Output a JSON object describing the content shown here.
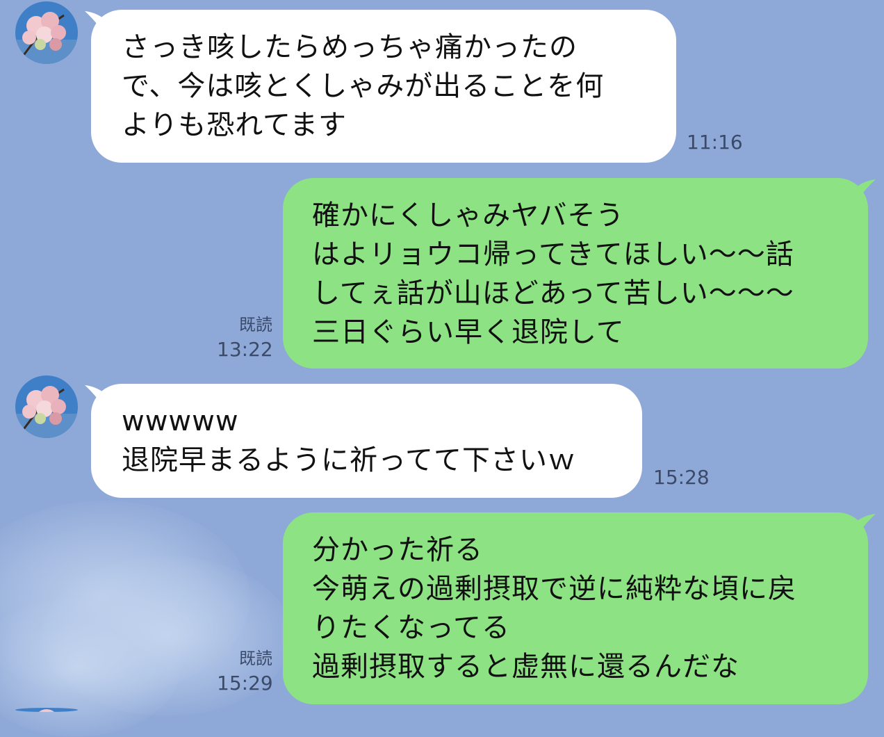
{
  "messages": [
    {
      "direction": "incoming",
      "lines": [
        "さっき咳したらめっちゃ痛かったの",
        "で、今は咳とくしゃみが出ることを何",
        "よりも恐れてます"
      ],
      "time": "11:16"
    },
    {
      "direction": "outgoing",
      "lines": [
        "確かにくしゃみヤバそう",
        "はよリョウコ帰ってきてほしい〜〜話",
        "してぇ話が山ほどあって苦しい〜〜〜",
        "三日ぐらい早く退院して"
      ],
      "read_label": "既読",
      "time": "13:22"
    },
    {
      "direction": "incoming",
      "lines": [
        "wwwww",
        "退院早まるように祈ってて下さいｗ"
      ],
      "time": "15:28"
    },
    {
      "direction": "outgoing",
      "lines": [
        "分かった祈る",
        "今萌えの過剰摂取で逆に純粋な頃に戻",
        "りたくなってる",
        "過剰摂取すると虚無に還るんだな"
      ],
      "read_label": "既読",
      "time": "15:29"
    }
  ],
  "colors": {
    "background": "#8ea8d7",
    "incoming_bubble": "#ffffff",
    "outgoing_bubble": "#8de383"
  },
  "icons": {
    "avatar": "cherry-blossom-avatar-icon"
  }
}
